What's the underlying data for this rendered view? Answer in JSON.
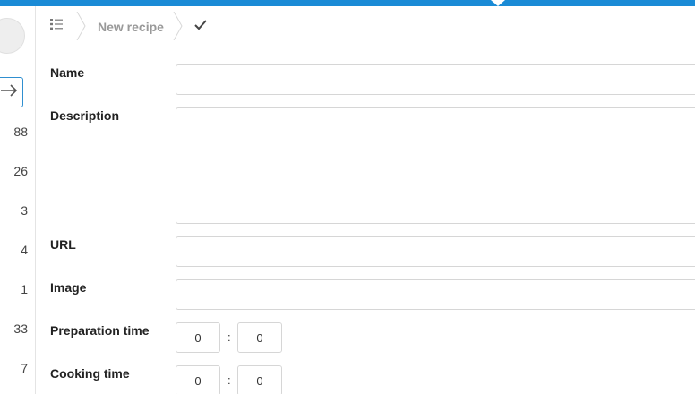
{
  "colors": {
    "accent": "#1a8bd6",
    "border": "#d6d6d6",
    "muted": "#999999"
  },
  "sidebar": {
    "avatar_icon": "avatar-placeholder",
    "login_icon": "arrow-right-login-icon",
    "counts": [
      "88",
      "26",
      "3",
      "4",
      "1",
      "33",
      "7"
    ]
  },
  "breadcrumb": {
    "list_icon": "list-icon",
    "current": "New recipe",
    "save_icon": "checkmark-icon"
  },
  "form": {
    "name": {
      "label": "Name",
      "value": ""
    },
    "description": {
      "label": "Description",
      "value": ""
    },
    "url": {
      "label": "URL",
      "value": ""
    },
    "image": {
      "label": "Image",
      "value": ""
    },
    "preparation_time": {
      "label": "Preparation time",
      "hours": "0",
      "separator": ":",
      "minutes": "0"
    },
    "cooking_time": {
      "label": "Cooking time",
      "hours": "0",
      "separator": ":",
      "minutes": "0"
    }
  }
}
